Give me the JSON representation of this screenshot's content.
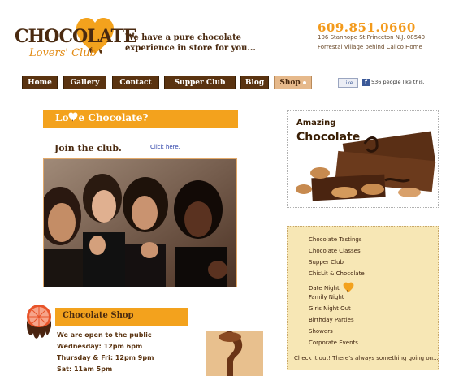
{
  "logo": {
    "title": "CHOCOLATE",
    "subtitle": "Lovers' Club"
  },
  "tagline": "We have a pure chocolate experience in store for you...",
  "contact": {
    "phone": "609.851.0660",
    "address_line1": "106 Stanhope St Princeton N.J. 08540",
    "address_line2": "Forrestal Village behind Calico Home"
  },
  "nav": {
    "items": [
      {
        "label": "Home"
      },
      {
        "label": "Gallery"
      },
      {
        "label": "Contact"
      },
      {
        "label": "Supper Club"
      },
      {
        "label": "Blog"
      },
      {
        "label": "Shop"
      }
    ]
  },
  "facebook": {
    "like_label": "Like",
    "icon": "f",
    "count_text": "536 people like this."
  },
  "love": {
    "title_part1": "Lo",
    "title_part2": "e Chocolate?",
    "join_text": "Join the club.",
    "click_here": "Click here."
  },
  "amazing": {
    "line1": "Amazing",
    "line2": "Chocolate"
  },
  "events": {
    "items": [
      "Chocolate Tastings",
      "Chocolate Classes",
      "Supper Club",
      "ChicLit & Chocolate",
      "Date Night",
      "Family Night",
      "Girls Night Out",
      "Birthday Parties",
      "Showers",
      "Corporate Events"
    ],
    "note": "Check it out! There's always something going on..."
  },
  "shop": {
    "title": "Chocolate Shop",
    "open_text": "We are open to the public",
    "hours": [
      "Wednesday: 12pm 6pm",
      "Thursday & Fri: 12pm 9pm",
      "Sat: 11am 5pm"
    ]
  },
  "colors": {
    "brown": "#4a2a10",
    "orange": "#f3a21d",
    "cream": "#f7e7b5",
    "link": "#2a3fa8"
  }
}
